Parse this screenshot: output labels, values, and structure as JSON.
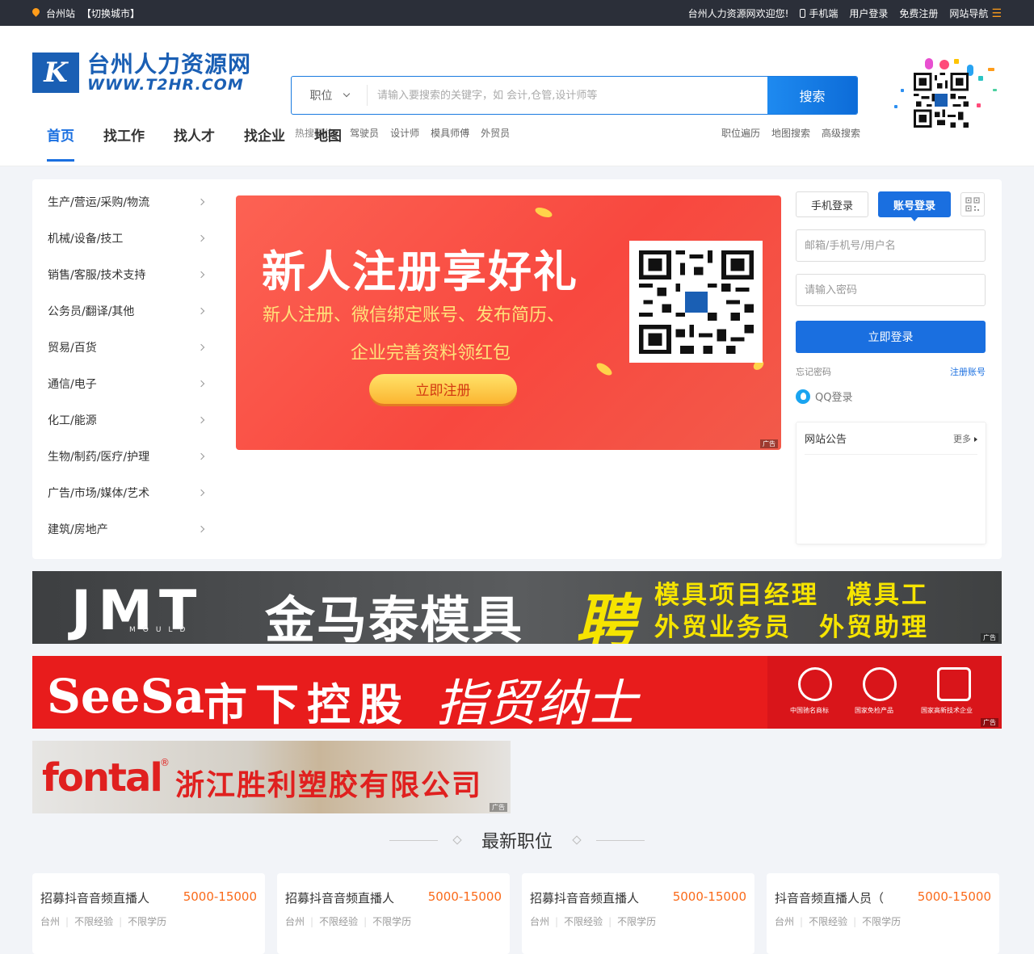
{
  "topbar": {
    "city": "台州站",
    "switch_city": "【切换城市】",
    "welcome": "台州人力资源网欢迎您!",
    "mobile": "手机端",
    "login": "用户登录",
    "register": "免费注册",
    "site_nav": "网站导航"
  },
  "logo": {
    "mark": "K",
    "cn": "台州人力资源网",
    "en": "WWW.T2HR.COM"
  },
  "search": {
    "type": "职位",
    "placeholder": "请输入要搜索的关键字，如 会计,仓管,设计师等",
    "button": "搜索"
  },
  "hot": {
    "label": "热搜职位:",
    "items": [
      "驾驶员",
      "设计师",
      "模具师傅",
      "外贸员"
    ]
  },
  "quick": [
    "职位遍历",
    "地图搜索",
    "高级搜索"
  ],
  "nav": [
    "首页",
    "找工作",
    "找人才",
    "找企业",
    "地图"
  ],
  "categories": [
    "生产/营运/采购/物流",
    "机械/设备/技工",
    "销售/客服/技术支持",
    "公务员/翻译/其他",
    "贸易/百货",
    "通信/电子",
    "化工/能源",
    "生物/制药/医疗/护理",
    "广告/市场/媒体/艺术",
    "建筑/房地产"
  ],
  "banner": {
    "title": "新人注册享好礼",
    "sub1": "新人注册、微信绑定账号、发布简历、",
    "sub2": "企业完善资料领红包",
    "button": "立即注册",
    "ad": "广告"
  },
  "login": {
    "tab_phone": "手机登录",
    "tab_account": "账号登录",
    "user_placeholder": "邮箱/手机号/用户名",
    "pwd_placeholder": "请输入密码",
    "button": "立即登录",
    "forgot": "忘记密码",
    "register": "注册账号",
    "qq": "QQ登录"
  },
  "notice": {
    "title": "网站公告",
    "more": "更多"
  },
  "ads": {
    "ad1": {
      "brand": "JMT",
      "mould": "MOULD",
      "cn": "金马泰模具",
      "pin": "聘",
      "line1": "模具项目经理　模具工",
      "line2": "外贸业务员　外贸助理",
      "tag": "广告"
    },
    "ad2": {
      "brand": "SeeSa",
      "cn": "市下控股",
      "sign": "指贸纳士",
      "cap1": "中国驰名商标",
      "cap2": "国家免检产品",
      "cap3": "国家高新技术企业",
      "tag": "广告"
    },
    "ad3": {
      "brand": "fontal",
      "reg": "®",
      "cn": "浙江胜利塑胶有限公司",
      "tag": "广告"
    }
  },
  "section": {
    "title": "最新职位"
  },
  "jobs": [
    {
      "title": "招募抖音音频直播人",
      "salary": "5000-15000",
      "city": "台州",
      "exp": "不限经验",
      "edu": "不限学历"
    },
    {
      "title": "招募抖音音频直播人",
      "salary": "5000-15000",
      "city": "台州",
      "exp": "不限经验",
      "edu": "不限学历"
    },
    {
      "title": "招募抖音音频直播人",
      "salary": "5000-15000",
      "city": "台州",
      "exp": "不限经验",
      "edu": "不限学历"
    },
    {
      "title": "抖音音频直播人员（",
      "salary": "5000-15000",
      "city": "台州",
      "exp": "不限经验",
      "edu": "不限学历"
    }
  ],
  "colors": {
    "primary": "#1a6fe0",
    "topbar": "#2b2f39",
    "accent": "#ff9c1a",
    "salary": "#fa6a1a",
    "banner_red": "#f8483f"
  },
  "icons": [
    "location-pin-icon",
    "phone-icon",
    "menu-icon",
    "chevron-down-icon",
    "chevron-right-icon",
    "qr-code-icon",
    "qq-icon"
  ]
}
